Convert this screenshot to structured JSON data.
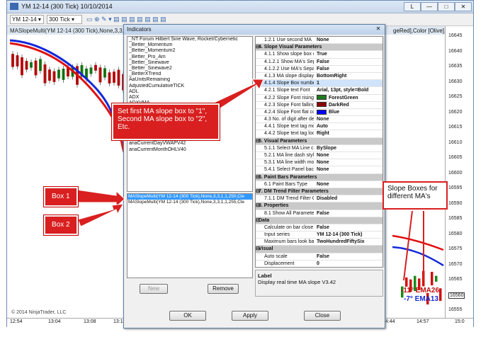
{
  "window": {
    "title": "YM 12-14 (300 Tick) 10/10/2014",
    "controls": [
      "L",
      "—",
      "□",
      "✕"
    ]
  },
  "toolbar": {
    "instrument": "YM 12-14",
    "interval": "300 Tick"
  },
  "chart_header": "MASlopeMulti(YM 12-14 (300 Tick),None,3,3,1,2",
  "chart_header_right": "geRed],Color [Olive],12",
  "y_axis_ticks": [
    "16645",
    "16640",
    "16635",
    "16630",
    "16625",
    "16620",
    "16615",
    "16610",
    "16605",
    "16600",
    "16595",
    "16590",
    "16585",
    "16580",
    "16575",
    "16570",
    "16565",
    "16560",
    "16555"
  ],
  "y_highlight": "16560",
  "x_axis_ticks": [
    "12:54",
    "13:04",
    "13:08",
    "13:17",
    "14:44",
    "14:57",
    "15:0"
  ],
  "copyright": "© 2014 NinjaTrader, LLC",
  "chart_annotations": {
    "slope1": "-11° EMA26",
    "slope2": "-7° EMA13"
  },
  "dialog": {
    "title": "Indicators",
    "indicator_list": [
      "_NT Forum Hilbert Sine Wave, Rocket/Cybernetic",
      "_Better_Momentum",
      "_Better_Momentum2",
      "_Better_Pro_Am",
      "_Better_Sinewave",
      "_Better_Sinewave2",
      "_BetterXTrend",
      "AaUnitsRemaining",
      "AdjustedCumulativeTICK",
      "ADL",
      "ADX",
      "ADXVMA",
      "anaButterworthFilter11",
      "anaCurrentDayOHLV40",
      "anaCurrentDayOHLV41",
      "anaCurrentDayOHLV42",
      "anaCurrentDayVWAPV40",
      "anaCurrentDayVWAPV41",
      "anaCurrentDayVWAPV42",
      "anaCurrentMonthOHLV40"
    ],
    "applied": [
      "MASlopeMulti(YM 12-14 (300 Tick),None,3,3,1,1,250,Cle",
      "MASlopeMulti(YM 12-14 (300 Tick),None,3,3,1,1,255,Cle"
    ],
    "new_button": "New",
    "remove_button": "Remove",
    "properties": [
      {
        "name": "1.2.1 Use second MA",
        "value": "None",
        "cat": false
      },
      {
        "name": "4. Slope Visual Parameters",
        "value": "",
        "cat": true
      },
      {
        "name": "4.1.1 Show slope box or",
        "value": "True",
        "cat": false
      },
      {
        "name": "4.1.2.1 Show MA's Sepa",
        "value": "False",
        "cat": false
      },
      {
        "name": "4.1.2.2 Use MA's Separ",
        "value": "False",
        "cat": false
      },
      {
        "name": "4.1.3 MA slope display",
        "value": "BottomRight",
        "cat": false
      },
      {
        "name": "4.1.4 Slope Box number",
        "value": "1",
        "cat": false,
        "hl": true
      },
      {
        "name": "4.2.1 Slope text Font",
        "value": "Arial, 13pt, style=Bold",
        "cat": false
      },
      {
        "name": "4.2.2 Slope Font rising",
        "value": "ForestGreen",
        "cat": false,
        "sw": "#1f7a1f"
      },
      {
        "name": "4.2.3 Slope Font falling",
        "value": "DarkRed",
        "cat": false,
        "sw": "#8b0000"
      },
      {
        "name": "4.2.4 Slope Font flat co",
        "value": "Blue",
        "cat": false,
        "sw": "#0000ff"
      },
      {
        "name": "4.3 No. of digit after dec",
        "value": "None",
        "cat": false
      },
      {
        "name": "4.4.1 Slope text tag mo",
        "value": "Auto",
        "cat": false
      },
      {
        "name": "4.4.2 Slope text tag loc",
        "value": "Right",
        "cat": false
      },
      {
        "name": "5. Visual Parameters",
        "value": "",
        "cat": true
      },
      {
        "name": "5.1.1 Select MA Line co",
        "value": "BySlope",
        "cat": false
      },
      {
        "name": "5.2.1 MA line dash style",
        "value": "None",
        "cat": false
      },
      {
        "name": "5.3.1 MA line width mo",
        "value": "None",
        "cat": false
      },
      {
        "name": "5.4.1 Select Panel back",
        "value": "None",
        "cat": false
      },
      {
        "name": "6. Paint Bars Parameters",
        "value": "",
        "cat": true
      },
      {
        "name": "6.1 Paint Bars Type",
        "value": "None",
        "cat": false
      },
      {
        "name": "7. DM Trend Filter Parameters",
        "value": "",
        "cat": true
      },
      {
        "name": "7.1.1 DM Trend Filter C",
        "value": "Disabled",
        "cat": false
      },
      {
        "name": "8. Properties",
        "value": "",
        "cat": true
      },
      {
        "name": "8.1 Show All Parameter",
        "value": "False",
        "cat": false
      },
      {
        "name": "Data",
        "value": "",
        "cat": true
      },
      {
        "name": "Calculate on bar close",
        "value": "False",
        "cat": false
      },
      {
        "name": "Input series",
        "value": "YM 12-14 (300 Tick)",
        "cat": false
      },
      {
        "name": "Maximum bars look bac",
        "value": "TwoHundredFiftySix",
        "cat": false
      },
      {
        "name": "Visual",
        "value": "",
        "cat": true
      },
      {
        "name": "Auto scale",
        "value": "False",
        "cat": false
      },
      {
        "name": "Displacement",
        "value": "0",
        "cat": false
      },
      {
        "name": "Display in Data Box",
        "value": "True",
        "cat": false
      }
    ],
    "label_title": "Label",
    "label_text": "Display real time MA slope V3.42",
    "ok_button": "OK",
    "apply_button": "Apply",
    "close_button": "Close"
  },
  "callouts": {
    "instruction": "Set first MA slope box to \"1\", Second MA slope box to \"2\", Etc.",
    "box1": "Box 1",
    "box2": "Box 2",
    "slope_boxes": "Slope Boxes for different MA's"
  },
  "colors": {
    "callout_red": "#d91f1f",
    "ma_red": "#e01010",
    "ma_blue": "#1428d8",
    "candle_up": "#1a8a1a",
    "candle_down": "#d01010"
  }
}
